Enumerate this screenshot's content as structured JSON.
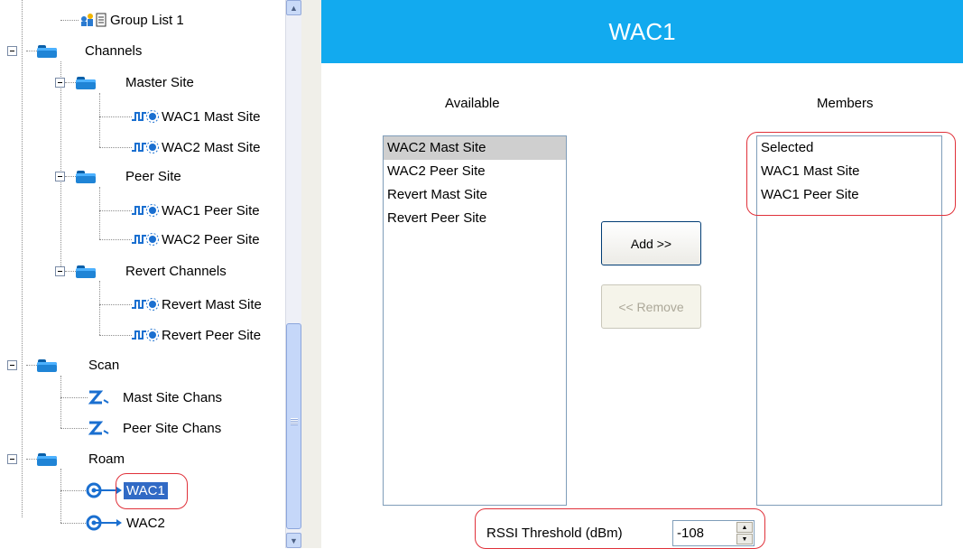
{
  "tree": {
    "items": [
      {
        "label": "Group List 1"
      },
      {
        "label": "Channels"
      },
      {
        "label": "Master Site"
      },
      {
        "label": "WAC1 Mast Site"
      },
      {
        "label": "WAC2 Mast Site"
      },
      {
        "label": "Peer Site"
      },
      {
        "label": "WAC1 Peer Site"
      },
      {
        "label": "WAC2 Peer Site"
      },
      {
        "label": "Revert Channels"
      },
      {
        "label": "Revert Mast Site"
      },
      {
        "label": "Revert Peer Site"
      },
      {
        "label": "Scan"
      },
      {
        "label": "Mast Site Chans"
      },
      {
        "label": "Peer Site Chans"
      },
      {
        "label": "Roam"
      },
      {
        "label": "WAC1"
      },
      {
        "label": "WAC2"
      }
    ],
    "selected": "WAC1"
  },
  "header": {
    "title": "WAC1"
  },
  "available": {
    "caption": "Available",
    "items": [
      "WAC2 Mast Site",
      "WAC2 Peer Site",
      "Revert Mast Site",
      "Revert Peer Site"
    ],
    "selected_index": 0
  },
  "members": {
    "caption": "Members",
    "items": [
      "Selected",
      "WAC1 Mast Site",
      "WAC1 Peer Site"
    ]
  },
  "buttons": {
    "add": "Add >>",
    "remove": "<< Remove"
  },
  "rssi": {
    "label": "RSSI Threshold (dBm)",
    "value": "-108"
  },
  "colors": {
    "header_bg": "#12aaef",
    "highlight": "#e0313a",
    "selection": "#316ac5"
  }
}
